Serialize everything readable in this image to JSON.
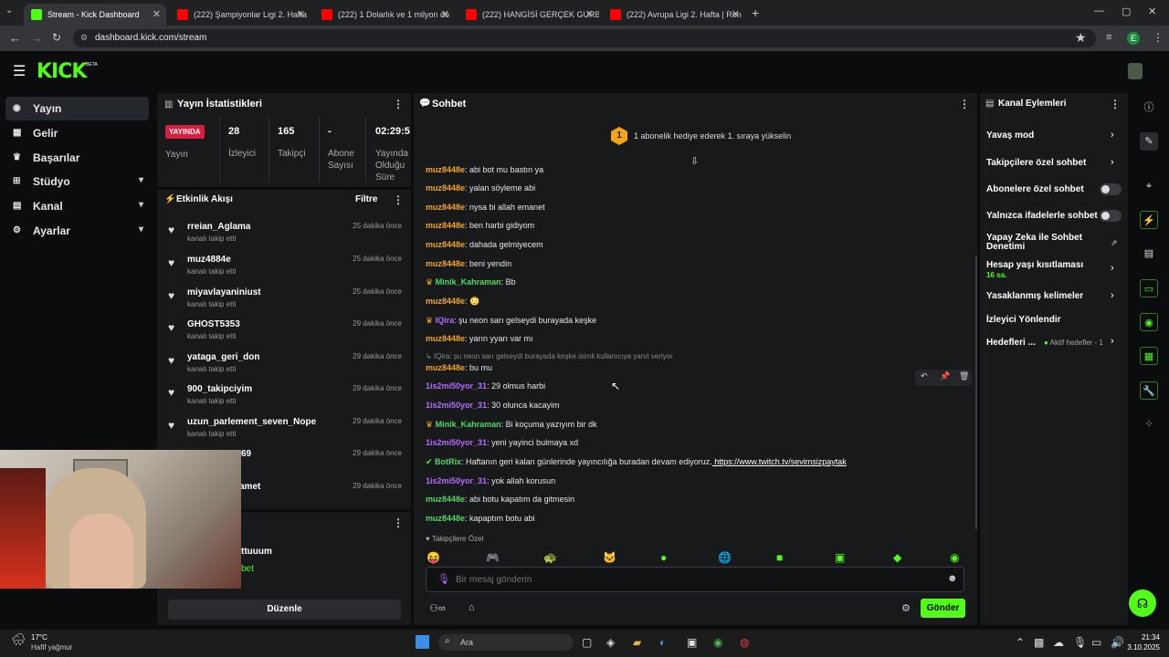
{
  "browser": {
    "tabs": [
      {
        "title": "Stream - Kick Dashboard",
        "active": true
      },
      {
        "title": "(222) Şampiyonlar Ligi 2. Hafta"
      },
      {
        "title": "(222) 1 Dolarlık ve 1 milyon do"
      },
      {
        "title": "(222) HANGİSİ GERÇEK GURBE"
      },
      {
        "title": "(222) Avrupa Ligi 2. Hafta | Ron"
      }
    ],
    "url": "dashboard.kick.com/stream",
    "profile_initial": "E"
  },
  "brand": {
    "logo": "KICK",
    "beta": "BETA",
    "accent": "#53fc18"
  },
  "sidebar": {
    "items": [
      {
        "label": "Yayın",
        "icon": "broadcast-icon"
      },
      {
        "label": "Gelir",
        "icon": "revenue-icon"
      },
      {
        "label": "Başarılar",
        "icon": "trophy-icon"
      },
      {
        "label": "Stüdyo",
        "icon": "studio-icon"
      },
      {
        "label": "Kanal",
        "icon": "channel-icon"
      },
      {
        "label": "Ayarlar",
        "icon": "settings-icon"
      }
    ]
  },
  "stats": {
    "title": "Yayın İstatistikleri",
    "live_badge": "YAYINDA",
    "live_label": "Yayın",
    "viewers": {
      "value": "28",
      "label": "İzleyici"
    },
    "followers": {
      "value": "165",
      "label": "Takipçi"
    },
    "subs": {
      "value": "-",
      "label": "Abone Sayısı"
    },
    "duration": {
      "value": "02:29:5",
      "label": "Yayında Olduğu Süre"
    }
  },
  "activity": {
    "title": "Etkinlik Akışı",
    "filter": "Filtre",
    "events": [
      {
        "name": "rreian_Aglama",
        "action": "kanalı takip etti",
        "time": "25 dakika önce"
      },
      {
        "name": "muz4884e",
        "action": "kanalı takip etti",
        "time": "25 dakika önce"
      },
      {
        "name": "miyavlayaniniust",
        "action": "kanalı takip etti",
        "time": "25 dakika önce"
      },
      {
        "name": "GHOST5353",
        "action": "kanalı takip etti",
        "time": "29 dakika önce"
      },
      {
        "name": "yataga_geri_don",
        "action": "kanalı takip etti",
        "time": "29 dakika önce"
      },
      {
        "name": "900_takipciyim",
        "action": "kanalı takip etti",
        "time": "29 dakika önce"
      },
      {
        "name": "uzun_parlement_seven_Nope",
        "action": "kanalı takip etti",
        "time": "29 dakika önce"
      },
      {
        "name": "69",
        "action": "",
        "time": "29 dakika önce"
      },
      {
        "name": "amet",
        "action": "",
        "time": "29 dakika önce"
      }
    ],
    "bottom_user": "ttuuum",
    "bottom_sub": "bet",
    "edit_button": "Düzenle"
  },
  "chat": {
    "title": "Sohbet",
    "goal_rank": "1",
    "goal_text": "1 abonelik hediye ederek 1. sıraya yükselin",
    "messages": [
      {
        "user": "muz8448e",
        "text": ": abi bot mu bastın ya",
        "color": "#f5a623"
      },
      {
        "user": "muz8448e",
        "text": ": yalan söyleme abi",
        "color": "#f5a623"
      },
      {
        "user": "muz8448e",
        "text": ": nysa bi allah emanet",
        "color": "#f5a623"
      },
      {
        "user": "muz8448e",
        "text": ": ben harbi gidiyom",
        "color": "#f5a623"
      },
      {
        "user": "muz8448e",
        "text": ": dahada gelmiyecem",
        "color": "#f5a623"
      },
      {
        "user": "muz8448e",
        "text": ": beni yendin",
        "color": "#f5a623"
      },
      {
        "user": "Minik_Kahraman",
        "text": ": Bb",
        "color": "#53d769",
        "badge": "crown"
      },
      {
        "user": "muz8448e",
        "text": ":",
        "color": "#f5a623",
        "emote": true
      },
      {
        "user": "IQira",
        "text": ": şu neon sarı gelseydi burayada keşke",
        "color": "#b36bff",
        "badge": "crown"
      },
      {
        "user": "muz8448e",
        "text": ": yarın yyarı var mı",
        "color": "#f5a623"
      }
    ],
    "reply_note": "↳ IQira: şu neon sarı gelseydi burayada keşke isimli kullanıcıya yanıt veriyor",
    "messages2": [
      {
        "user": "muz8448e",
        "text": ": bu mu",
        "color": "#f5a623"
      },
      {
        "user": "1is2mi50yor_31",
        "text": ": 29 olmus harbi",
        "color": "#b36bff"
      },
      {
        "user": "1is2mi50yor_31",
        "text": ": 30 olunca kacayim",
        "color": "#b36bff"
      },
      {
        "user": "Minik_Kahraman",
        "text": ": Bi koçuma yazıyım bir dk",
        "color": "#53d769",
        "badge": "crown"
      },
      {
        "user": "1is2mi50yor_31",
        "text": ": yeni yayinci bulmaya xd",
        "color": "#b36bff"
      },
      {
        "user": "BotRix",
        "text": ": Haftanın geri kalan günlerinde yayıncılığa buradan devam ediyoruz.",
        "color": "#53d769",
        "badge": "bot",
        "link": "https://www.twitch.tv/sevimsizpaytak"
      },
      {
        "user": "1is2mi50yor_31",
        "text": ": yok allah korusun",
        "color": "#b36bff"
      },
      {
        "user": "muz8448e",
        "text": ": abi botu kapatım da gitmesin",
        "color": "#53d769"
      },
      {
        "user": "muz8448e",
        "text": ": kapaptım botu abi",
        "color": "#53d769"
      }
    ],
    "followers_only": "Takipçilere Özel",
    "input_placeholder": "Bir mesaj gönderin",
    "send_button": "Gönder"
  },
  "channel_actions": {
    "title": "Kanal Eylemleri",
    "items": [
      {
        "label": "Yavaş mod",
        "type": "chevron"
      },
      {
        "label": "Takipçilere özel sohbet",
        "type": "chevron"
      },
      {
        "label": "Abonelere özel sohbet",
        "type": "toggle"
      },
      {
        "label": "Yalnızca ifadelerle sohbet",
        "type": "toggle"
      },
      {
        "label": "Yapay Zeka ile Sohbet Denetimi",
        "type": "external"
      },
      {
        "label": "Hesap yaşı kısıtlaması",
        "sub": "16 sa.",
        "type": "chevron"
      },
      {
        "label": "Yasaklanmış kelimeler",
        "type": "chevron"
      },
      {
        "label": "İzleyici Yönlendir",
        "type": "none"
      },
      {
        "label": "Hedefleri ...",
        "sub": "Aktif hedefler - 1",
        "type": "chevron"
      }
    ]
  },
  "taskbar": {
    "weather_temp": "17°C",
    "weather_desc": "Hafif yağmur",
    "search": "Ara",
    "time": "21:34",
    "date": "3.10.2025"
  }
}
